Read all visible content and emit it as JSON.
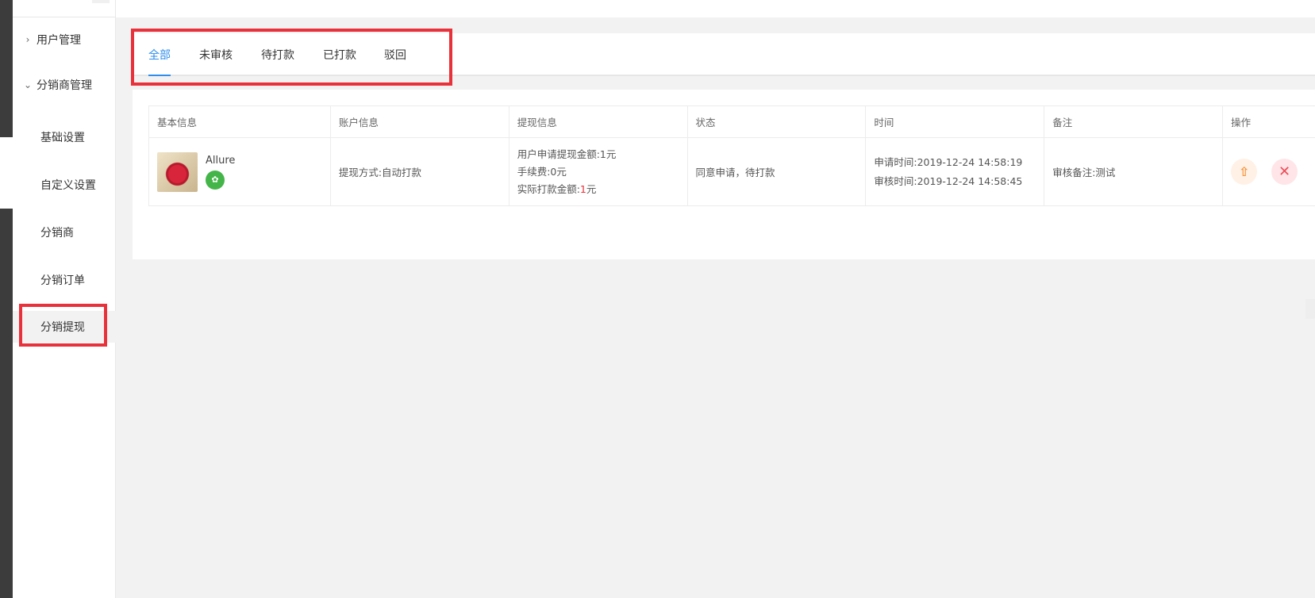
{
  "sidebar": {
    "groups": [
      {
        "label": "用户管理",
        "chevron": "›",
        "icon": "chevron-right-icon"
      },
      {
        "label": "分销商管理",
        "chevron": "⌄",
        "icon": "chevron-down-icon"
      }
    ],
    "items": [
      {
        "label": "基础设置"
      },
      {
        "label": "自定义设置"
      },
      {
        "label": "分销商"
      },
      {
        "label": "分销订单"
      },
      {
        "label": "分销提现"
      }
    ]
  },
  "tabs": [
    {
      "label": "全部"
    },
    {
      "label": "未审核"
    },
    {
      "label": "待打款"
    },
    {
      "label": "已打款"
    },
    {
      "label": "驳回"
    }
  ],
  "table": {
    "headers": [
      "基本信息",
      "账户信息",
      "提现信息",
      "状态",
      "时间",
      "备注",
      "操作"
    ],
    "row": {
      "user_name": "Allure",
      "wechat_glyph": "✿",
      "account": "提现方式:自动打款",
      "withdraw_apply": "用户申请提现金额:1元",
      "withdraw_fee": "手续费:0元",
      "withdraw_actual_label": "实际打款金额:",
      "withdraw_actual_value": "1",
      "withdraw_actual_unit": "元",
      "status": "同意申请，待打款",
      "apply_time": "申请时间:2019-12-24 14:58:19",
      "review_time": "审核时间:2019-12-24 14:58:45",
      "remark": "审核备注:测试",
      "pay_glyph": "⇧",
      "reject_glyph": "✕"
    }
  },
  "colors": {
    "accent": "#2e8ded",
    "highlight": "#e8313a",
    "wechat": "#44b549"
  }
}
